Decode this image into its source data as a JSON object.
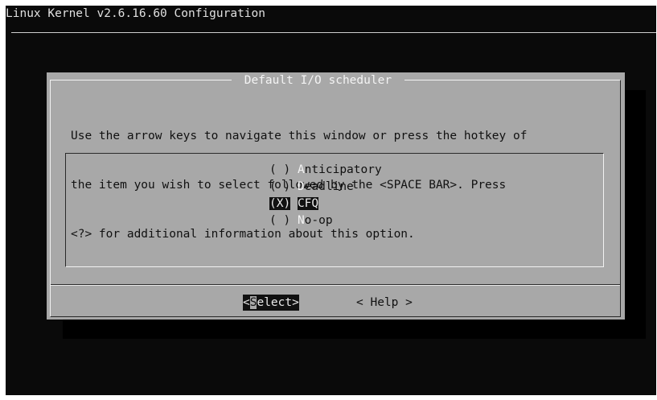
{
  "window": {
    "title": "Linux Kernel v2.6.16.60 Configuration"
  },
  "dialog": {
    "title": " Default I/O scheduler ",
    "prompt_lines": [
      "Use the arrow keys to navigate this window or press the hotkey of",
      "the item you wish to select followed by the <SPACE BAR>. Press",
      "<?> for additional information about this option."
    ],
    "options": [
      {
        "mark": "( )",
        "hotkey": "A",
        "rest": "nticipatory",
        "selected": false
      },
      {
        "mark": "( )",
        "hotkey": "D",
        "rest": "eadline",
        "selected": false
      },
      {
        "mark": "(X)",
        "hotkey": "C",
        "rest": "FQ",
        "selected": true
      },
      {
        "mark": "( )",
        "hotkey": "N",
        "rest": "o-op",
        "selected": false
      }
    ],
    "buttons": {
      "select": {
        "prefix": "<",
        "hotkey": "S",
        "rest": "elect>"
      },
      "help": {
        "label": "< Help >"
      }
    }
  },
  "colors": {
    "screen_bg": "#0a0a0a",
    "dialog_bg": "#a8a8a8",
    "highlight_bg": "#111111"
  }
}
